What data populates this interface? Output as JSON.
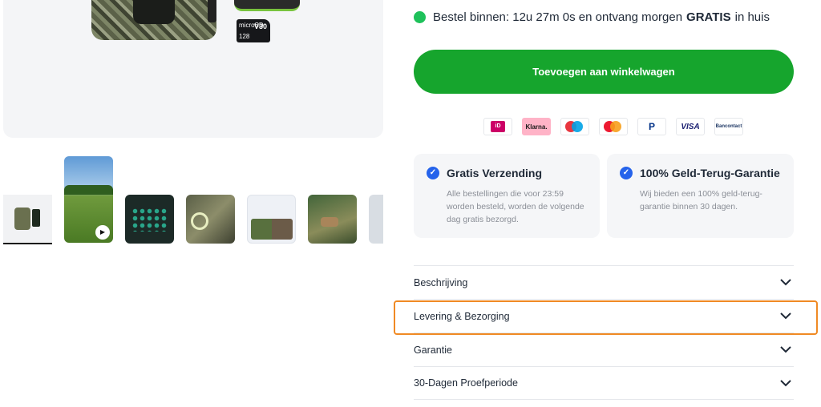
{
  "delivery": {
    "text_before": "Bestel binnen: 12u 27m 0s en ontvang morgen",
    "text_strong": "GRATIS",
    "text_after": "in huis",
    "status_color": "#1ec15a"
  },
  "cart_button": {
    "label": "Toevoegen aan winkelwagen",
    "color": "#16a52d"
  },
  "gallery": {
    "sdcard_brand": "microSD",
    "sdcard_speed": "V30",
    "sdcard_size": "128",
    "thumbnails": [
      {
        "kind": "product",
        "selected": true
      },
      {
        "kind": "video",
        "icon": "play-icon"
      },
      {
        "kind": "image"
      },
      {
        "kind": "image"
      },
      {
        "kind": "image"
      },
      {
        "kind": "image"
      },
      {
        "kind": "image"
      }
    ]
  },
  "payments": {
    "ideal": "iD",
    "klarna": "Klarna.",
    "maestro": "maestro",
    "mastercard": "mastercard",
    "paypal": "P",
    "visa": "VISA",
    "bancontact": "Bancontact"
  },
  "usps": [
    {
      "title": "Gratis Verzending",
      "text": "Alle bestellingen die voor 23:59 worden besteld, worden de volgende dag gratis bezorgd.",
      "icon": "check-circle-icon"
    },
    {
      "title": "100% Geld-Terug-Garantie",
      "text": "Wij bieden een 100% geld-terug-garantie binnen 30 dagen.",
      "icon": "check-circle-icon"
    }
  ],
  "accordion": [
    {
      "label": "Beschrijving",
      "highlighted": false
    },
    {
      "label": "Levering & Bezorging",
      "highlighted": true
    },
    {
      "label": "Garantie",
      "highlighted": false
    },
    {
      "label": "30-Dagen Proefperiode",
      "highlighted": false
    }
  ],
  "colors": {
    "highlight": "#f08a24",
    "check": "#2563eb"
  }
}
